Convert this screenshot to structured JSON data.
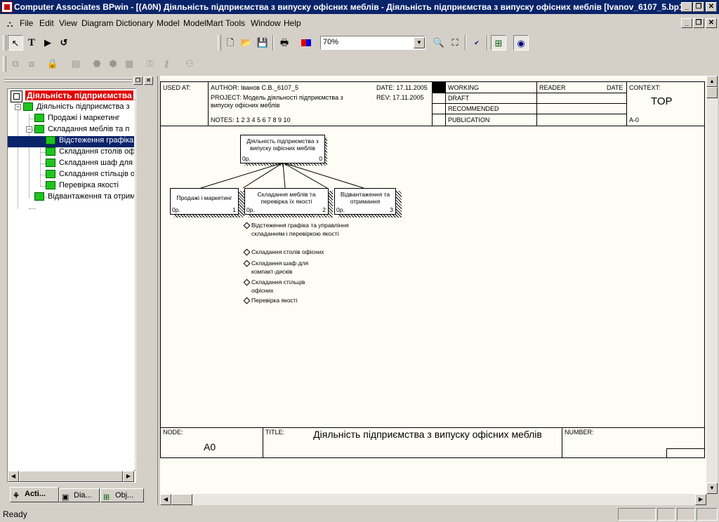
{
  "window": {
    "title": "Computer Associates BPwin - [(A0N) Діяльність підприємства  з випуску офісних меблів - Діяльність підприємства з випуску офісних меблів  [Ivanov_6107_5.bp1]]"
  },
  "menu": {
    "items": [
      "File",
      "Edit",
      "View",
      "Diagram",
      "Dictionary",
      "Model",
      "ModelMart",
      "Tools",
      "Window",
      "Help"
    ]
  },
  "toolbar": {
    "zoom_value": "70%"
  },
  "tree": {
    "root": "Діяльність підприємства",
    "items": [
      "Діяльність підприємства  з",
      "Продажі і маркетинг",
      "Складання меблів та  п",
      "Відстеження графіка",
      "Складання столів оф",
      "Складання шаф для",
      "Складання стільців о",
      "Перевірка якості",
      "Відвантаження та отрим"
    ],
    "tabs": [
      "Acti...",
      "Dia...",
      "Obj..."
    ]
  },
  "diagram": {
    "header": {
      "used_at_label": "USED AT:",
      "author": "AUTHOR:  Іванов  С.В._6107_5",
      "project_line1": "PROJECT:  Модель діяльності підприємства з",
      "project_line2": "випуску офісних меблів",
      "notes": "NOTES:  1  2  3  4  5  6  7  8  9  10",
      "date": "DATE:  17.11.2005",
      "rev": "REV:   17.11.2005",
      "statuses": [
        "WORKING",
        "DRAFT",
        "RECOMMENDED",
        "PUBLICATION"
      ],
      "reader_label": "READER",
      "date_label": "DATE",
      "context_label": "CONTEXT:",
      "context_value": "TOP",
      "context_node": "A-0"
    },
    "root_activity": {
      "name": "Діяльність підприємства з випуску офісних меблів",
      "cost": "0р.",
      "number": "0"
    },
    "activities": [
      {
        "name": "Продажі і маркетинг",
        "cost": "0р.",
        "number": "1"
      },
      {
        "name": "Складання меблів та перевірка їх якості",
        "cost": "0р.",
        "number": "2"
      },
      {
        "name": "Відвантаження та отримання",
        "cost": "0р.",
        "number": "3"
      }
    ],
    "decomposition": [
      "Відстеження графіка та управління складанням і перевіркою якості",
      "Складання столів офісних",
      "Складання шаф для компакт-дисків",
      "Складання стільців офісних",
      "Перевірка якості"
    ],
    "footer": {
      "node_label": "NODE:",
      "node_value": "A0",
      "title_label": "TITLE:",
      "title_value": "Діяльність підприємства  з випуску офісних меблів",
      "number_label": "NUMBER:"
    }
  },
  "status": {
    "text": "Ready"
  }
}
